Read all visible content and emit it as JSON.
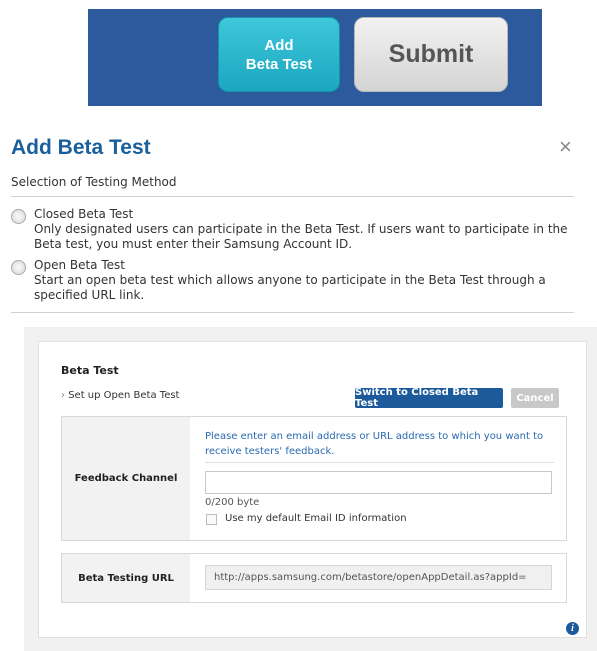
{
  "banner": {
    "add_line1": "Add",
    "add_line2": "Beta Test",
    "submit_label": "Submit"
  },
  "dialog": {
    "title": "Add Beta Test",
    "close_glyph": "×",
    "section_label": "Selection of Testing Method",
    "options": [
      {
        "label": "Closed Beta Test",
        "description": "Only designated users can participate in the Beta Test. If users want to participate in the Beta test, you must enter their Samsung Account ID.",
        "selected": false
      },
      {
        "label": "Open Beta Test",
        "description": "Start an open beta test which allows anyone to participate in the Beta Test through a specified URL link.",
        "selected": false
      }
    ]
  },
  "beta_panel": {
    "title": "Beta Test",
    "setup_label": "Set up Open Beta Test",
    "switch_button": "Switch to Closed Beta Test",
    "cancel_button": "Cancel",
    "feedback": {
      "label": "Feedback Channel",
      "hint": "Please enter an email address or URL address to which you want to receive testers' feedback.",
      "input_value": "",
      "counter": "0/200 byte",
      "checkbox_label": "Use my default Email ID information",
      "checkbox_checked": false
    },
    "url": {
      "label": "Beta Testing URL",
      "value": "http://apps.samsung.com/betastore/openAppDetail.as?appId="
    },
    "info_glyph": "i"
  },
  "colors": {
    "banner_bg": "#2c5a9c",
    "add_button": "#1aa7c0",
    "title_blue": "#1a5f9c",
    "primary_button": "#1c5a9c",
    "hint_text": "#2a6ab0"
  }
}
